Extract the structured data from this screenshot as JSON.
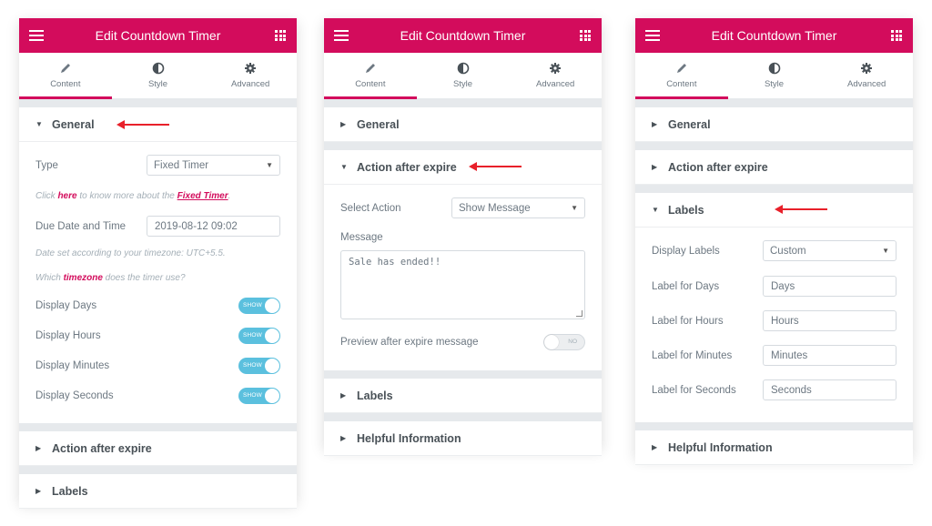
{
  "header": {
    "title": "Edit Countdown Timer",
    "menu_icon": "hamburger-menu-icon",
    "apps_icon": "grid-icon"
  },
  "tabs": [
    {
      "label": "Content",
      "icon": "pencil-icon"
    },
    {
      "label": "Style",
      "icon": "half-circle-icon"
    },
    {
      "label": "Advanced",
      "icon": "gear-icon"
    }
  ],
  "sections": {
    "general": "General",
    "action": "Action after expire",
    "labels": "Labels",
    "helpful": "Helpful Information"
  },
  "general": {
    "type_label": "Type",
    "type_value": "Fixed Timer",
    "click_note": {
      "pre": "Click ",
      "link": "here",
      "mid": " to know more about the ",
      "link2": "Fixed Timer",
      "post": "."
    },
    "due_label": "Due Date and Time",
    "due_value": "2019-08-12 09:02",
    "tz_note": "Date set according to your timezone: UTC+5.5.",
    "which_note": {
      "pre": "Which ",
      "link": "timezone",
      "post": " does the timer use?"
    },
    "toggles": [
      {
        "label": "Display Days",
        "state": "SHOW"
      },
      {
        "label": "Display Hours",
        "state": "SHOW"
      },
      {
        "label": "Display Minutes",
        "state": "SHOW"
      },
      {
        "label": "Display Seconds",
        "state": "SHOW"
      }
    ]
  },
  "action": {
    "select_label": "Select Action",
    "select_value": "Show Message",
    "message_label": "Message",
    "message_value": "Sale has ended!!",
    "preview_label": "Preview after expire message",
    "preview_state": "NO"
  },
  "labels": {
    "display_label": "Display Labels",
    "display_value": "Custom",
    "fields": [
      {
        "label": "Label for Days",
        "value": "Days"
      },
      {
        "label": "Label for Hours",
        "value": "Hours"
      },
      {
        "label": "Label for Minutes",
        "value": "Minutes"
      },
      {
        "label": "Label for Seconds",
        "value": "Seconds"
      }
    ]
  },
  "colors": {
    "brand": "#d30c5c",
    "toggle_on": "#5bc0de",
    "arrow": "#e8202a",
    "panel_bg": "#e6e9ec"
  }
}
